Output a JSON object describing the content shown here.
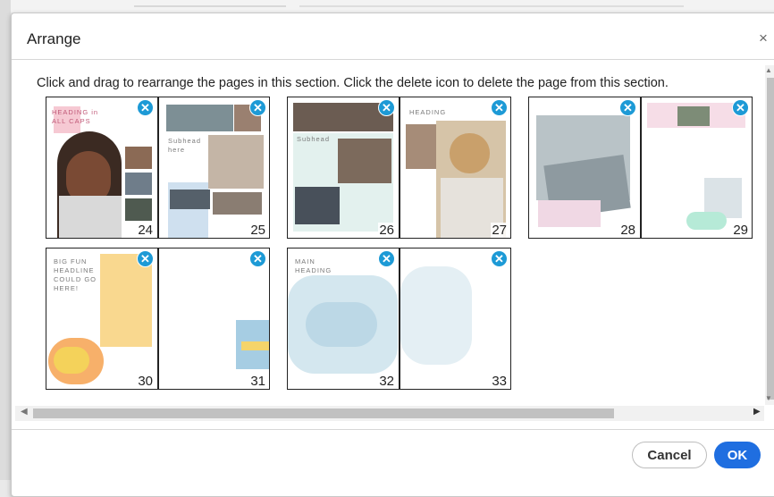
{
  "dialog": {
    "title": "Arrange",
    "close_glyph": "×",
    "instruction": "Click and drag to rearrange the pages in this section. Click the delete icon to delete the page from this section.",
    "delete_glyph": "✕",
    "pages": [
      {
        "number": "24",
        "text": "HEADING in ALL CAPS"
      },
      {
        "number": "25",
        "text": "Subhead here"
      },
      {
        "number": "26",
        "text": "Subhead"
      },
      {
        "number": "27",
        "text": "HEADING"
      },
      {
        "number": "28",
        "text": ""
      },
      {
        "number": "29",
        "text": ""
      },
      {
        "number": "30",
        "text": "BIG FUN HEADLINE COULD GO HERE!"
      },
      {
        "number": "31",
        "text": ""
      },
      {
        "number": "32",
        "text": "MAIN HEADING"
      },
      {
        "number": "33",
        "text": ""
      }
    ],
    "buttons": {
      "cancel": "Cancel",
      "ok": "OK"
    },
    "colors": {
      "delete_icon": "#1d9ad6",
      "ok_button": "#1f6ee0"
    }
  }
}
